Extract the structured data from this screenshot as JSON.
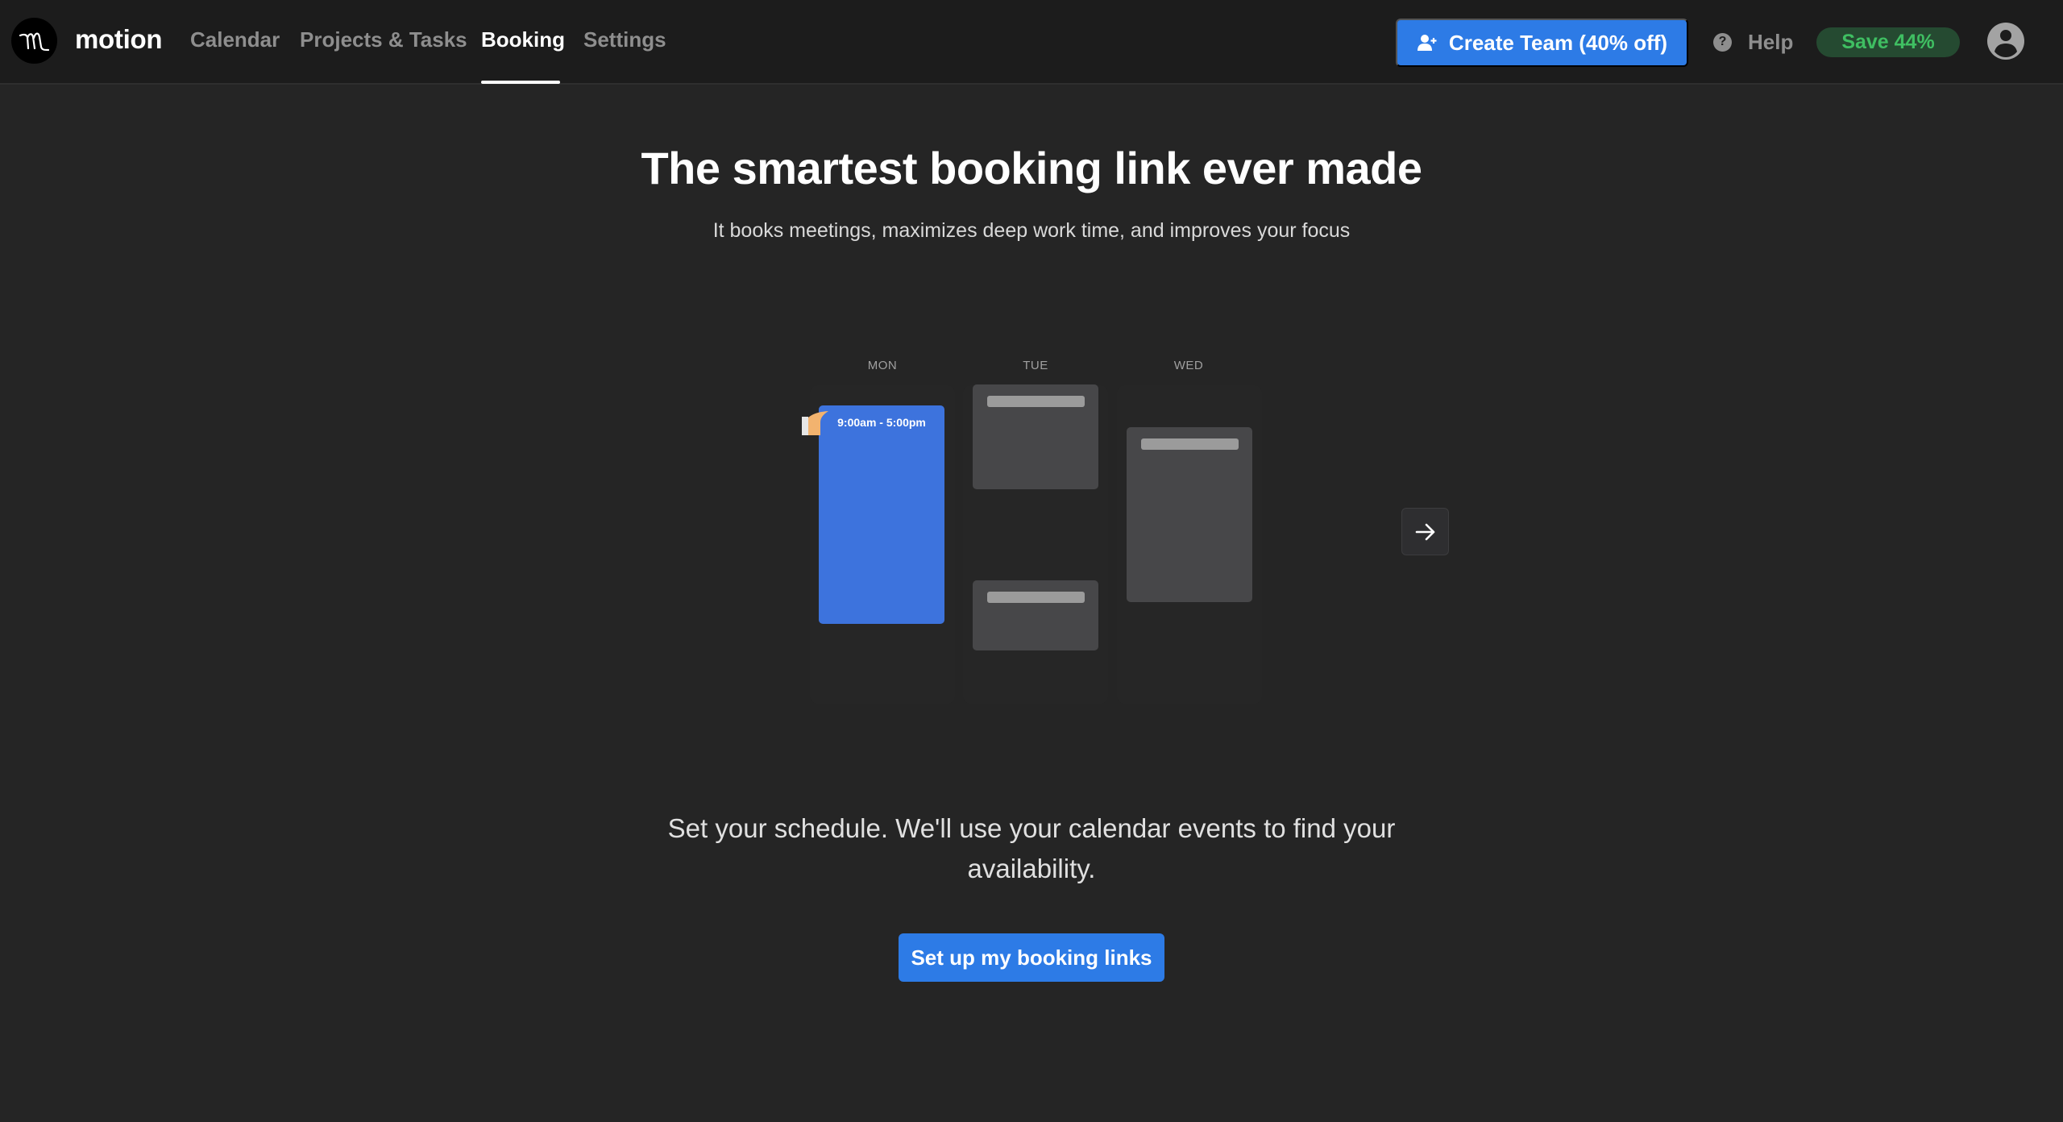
{
  "header": {
    "brand": "motion",
    "nav": [
      {
        "label": "Calendar",
        "active": false
      },
      {
        "label": "Projects & Tasks",
        "active": false
      },
      {
        "label": "Booking",
        "active": true
      },
      {
        "label": "Settings",
        "active": false
      }
    ],
    "create_team_label": "Create Team (40% off)",
    "help_label": "Help",
    "save_badge": "Save 44%",
    "colors": {
      "accent": "#2d7be6",
      "save_text": "#3fbf62",
      "save_bg": "#254a31"
    }
  },
  "hero": {
    "title": "The smartest booking link ever made",
    "subtitle": "It books meetings, maximizes deep work time, and improves your focus"
  },
  "illustration": {
    "days": [
      "MON",
      "TUE",
      "WED"
    ],
    "availability_label": "9:00am - 5:00pm",
    "icons": [
      "hand-pointer-icon",
      "arrow-right-icon"
    ]
  },
  "cta_section": {
    "description": "Set your schedule. We'll use your calendar events to find your availability.",
    "button_label": "Set up my booking links"
  }
}
